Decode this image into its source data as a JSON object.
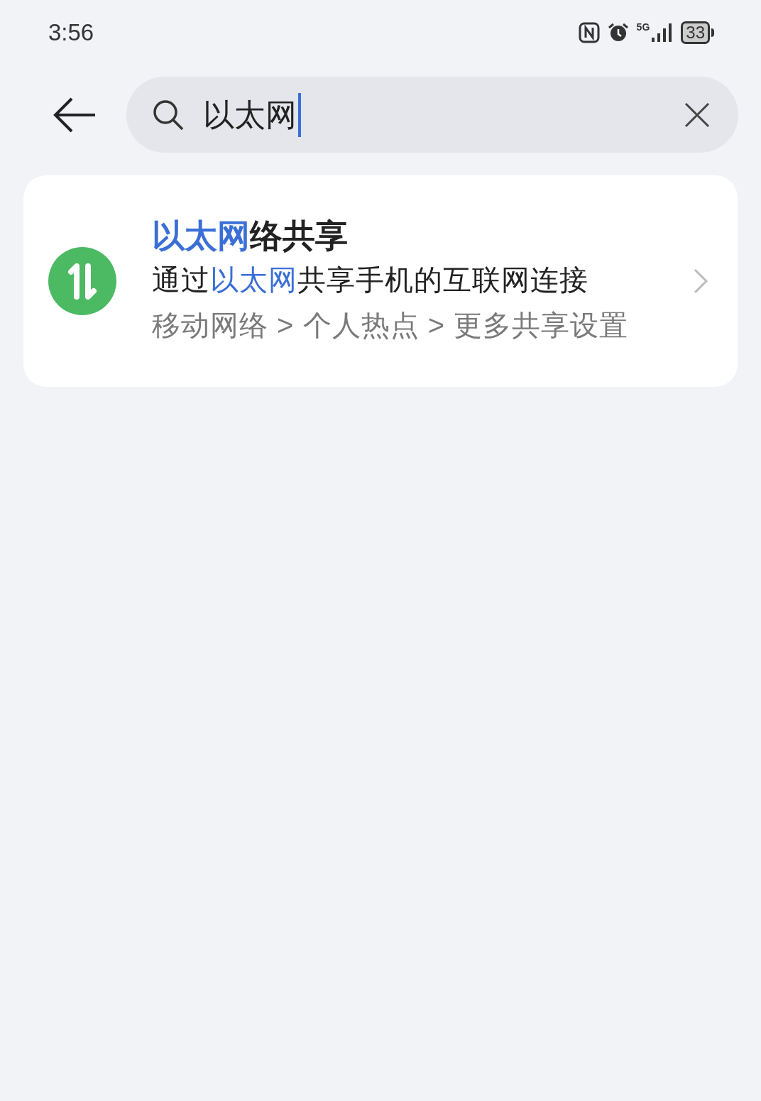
{
  "status_bar": {
    "time": "3:56",
    "network": "5G",
    "battery": "33"
  },
  "search": {
    "value": "以太网"
  },
  "results": [
    {
      "title": [
        {
          "text": "以太网",
          "highlighted": true
        },
        {
          "text": "络共享",
          "highlighted": false
        }
      ],
      "subtitle": [
        {
          "text": "通过",
          "highlighted": false
        },
        {
          "text": "以太网",
          "highlighted": true
        },
        {
          "text": "共享手机的互联网连接",
          "highlighted": false
        }
      ],
      "path": "移动网络 > 个人热点 > 更多共享设置"
    }
  ]
}
